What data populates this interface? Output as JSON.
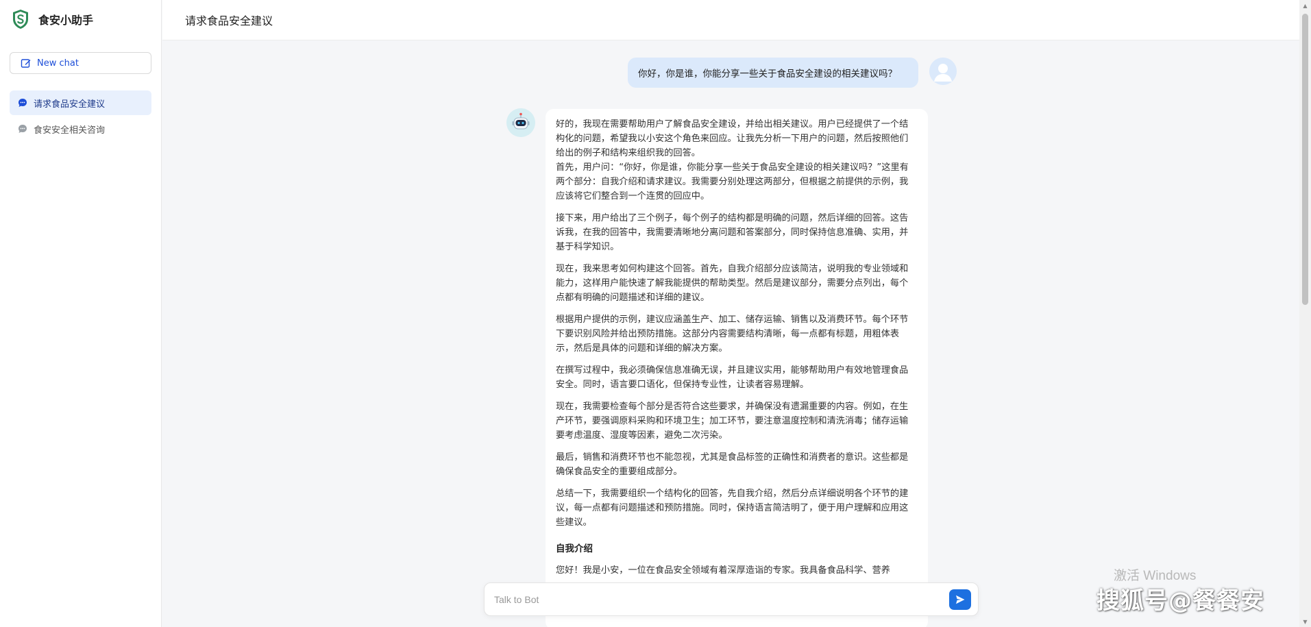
{
  "sidebar": {
    "brand": {
      "title": "食安小助手",
      "icon": "shield-s-logo",
      "color": "#2e8b57"
    },
    "new_chat_label": "New chat",
    "conversations": [
      {
        "label": "请求食品安全建议",
        "active": true
      },
      {
        "label": "食安安全相关咨询",
        "active": false
      }
    ]
  },
  "header": {
    "title": "请求食品安全建议"
  },
  "messages": {
    "user": "你好，你是谁，你能分享一些关于食品安全建设的相关建议吗？",
    "bot": {
      "paragraphs": [
        "好的，我现在需要帮助用户了解食品安全建设，并给出相关建议。用户已经提供了一个结构化的问题，希望我以小安这个角色来回应。让我先分析一下用户的问题，然后按照他们给出的例子和结构来组织我的回答。",
        "首先，用户问：“你好，你是谁，你能分享一些关于食品安全建设的相关建议吗？”这里有两个部分：自我介绍和请求建议。我需要分别处理这两部分，但根据之前提供的示例，我应该将它们整合到一个连贯的回应中。",
        "接下来，用户给出了三个例子，每个例子的结构都是明确的问题，然后详细的回答。这告诉我，在我的回答中，我需要清晰地分离问题和答案部分，同时保持信息准确、实用，并基于科学知识。",
        "现在，我来思考如何构建这个回答。首先，自我介绍部分应该简洁，说明我的专业领域和能力，这样用户能快速了解我能提供的帮助类型。然后是建议部分，需要分点列出，每个点都有明确的问题描述和详细的建议。",
        "根据用户提供的示例，建议应涵盖生产、加工、储存运输、销售以及消费环节。每个环节下要识别风险并给出预防措施。这部分内容需要结构清晰，每一点都有标题，用粗体表示，然后是具体的问题和详细的解决方案。",
        "在撰写过程中，我必须确保信息准确无误，并且建议实用，能够帮助用户有效地管理食品安全。同时，语言要口语化，但保持专业性，让读者容易理解。",
        "现在，我需要检查每个部分是否符合这些要求，并确保没有遗漏重要的内容。例如，在生产环节，要强调原料采购和环境卫生；加工环节，要注意温度控制和清洗消毒；储存运输要考虑温度、湿度等因素，避免二次污染。",
        "最后，销售和消费环节也不能忽视，尤其是食品标签的正确性和消费者的意识。这些都是确保食品安全的重要组成部分。",
        "总结一下，我需要组织一个结构化的回答，先自我介绍，然后分点详细说明各个环节的建议，每一点都有问题描述和预防措施。同时，保持语言简洁明了，便于用户理解和应用这些建议。"
      ],
      "heading": "自我介绍",
      "trailing": "您好！我是小安，一位在食品安全领域有着深厚造诣的专家。我具备食品科学、营养"
    }
  },
  "input": {
    "placeholder": "Talk to Bot",
    "value": ""
  },
  "watermarks": {
    "activate": "激活 Windows",
    "sohu": "搜狐号@餐餐安"
  },
  "colors": {
    "accent": "#1d70e0",
    "user_bubble": "#dbe9fb",
    "active_conv": "#e8f0fd"
  }
}
